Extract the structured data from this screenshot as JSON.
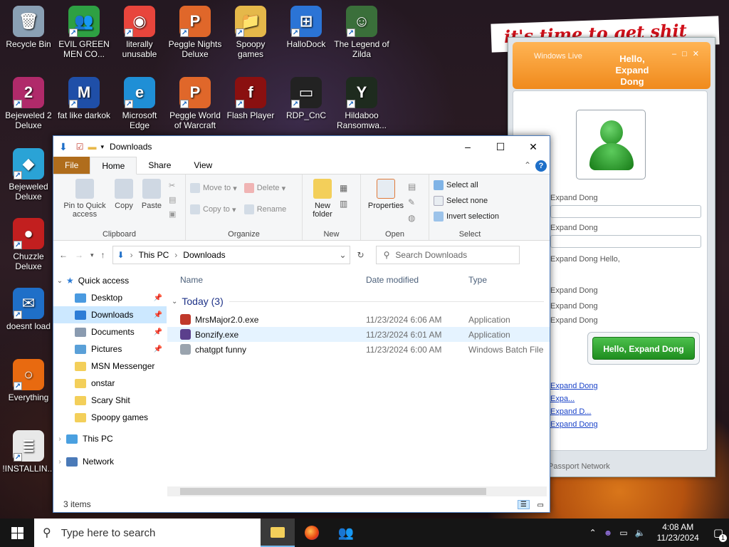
{
  "desktop": {
    "banner": "it's time to get shit",
    "icons": [
      {
        "label": "Recycle Bin",
        "color": "#8aa0b4",
        "glyph": "🗑"
      },
      {
        "label": "EVIL GREEN MEN CO...",
        "color": "#2ea043",
        "glyph": "👥"
      },
      {
        "label": "literally unusable",
        "color": "#e8453c",
        "glyph": "◉"
      },
      {
        "label": "Peggle Nights Deluxe",
        "color": "#e0672a",
        "glyph": "P"
      },
      {
        "label": "Spoopy games",
        "color": "#e5b84a",
        "glyph": "📁"
      },
      {
        "label": "HalloDock",
        "color": "#2b74d6",
        "glyph": "⊞"
      },
      {
        "label": "The Legend of Zilda",
        "color": "#3a6f3a",
        "glyph": "☺"
      },
      {
        "label": "Bejeweled 2 Deluxe",
        "color": "#b02a6a",
        "glyph": "2"
      },
      {
        "label": "fat like darkok",
        "color": "#1f4fa8",
        "glyph": "M"
      },
      {
        "label": "Microsoft Edge",
        "color": "#1f8fd6",
        "glyph": "e"
      },
      {
        "label": "Peggle World of Warcraft",
        "color": "#e0672a",
        "glyph": "P"
      },
      {
        "label": "Flash Player",
        "color": "#8a1010",
        "glyph": "f"
      },
      {
        "label": "RDP_CnC",
        "color": "#222222",
        "glyph": "▭"
      },
      {
        "label": "Hildaboo Ransomwa...",
        "color": "#1e2b1e",
        "glyph": "Y"
      },
      {
        "label": "Bejeweled Deluxe",
        "color": "#2aa3d6",
        "glyph": "◆"
      },
      {
        "label": "Chuzzle Deluxe",
        "color": "#c21f1f",
        "glyph": "●"
      },
      {
        "label": "doesnt load",
        "color": "#1f6fc8",
        "glyph": "✉"
      },
      {
        "label": "Everything",
        "color": "#e86a10",
        "glyph": "○"
      },
      {
        "label": "!INSTALLIN...",
        "color": "#e8e8e8",
        "glyph": "≣"
      }
    ]
  },
  "explorer": {
    "title": "Downloads",
    "tabs": {
      "file": "File",
      "home": "Home",
      "share": "Share",
      "view": "View"
    },
    "ribbon": {
      "pin": "Pin to Quick access",
      "copy": "Copy",
      "paste": "Paste",
      "clipboard": "Clipboard",
      "move_to": "Move to",
      "copy_to": "Copy to",
      "delete": "Delete",
      "rename": "Rename",
      "organize": "Organize",
      "new_folder": "New folder",
      "new": "New",
      "properties": "Properties",
      "open": "Open",
      "select_all": "Select all",
      "select_none": "Select none",
      "invert_selection": "Invert selection",
      "select": "Select"
    },
    "address": {
      "root": "This PC",
      "current": "Downloads",
      "search_placeholder": "Search Downloads"
    },
    "nav": {
      "quick_access": "Quick access",
      "items": [
        {
          "label": "Desktop",
          "pinned": true,
          "color": "#4a9ae0"
        },
        {
          "label": "Downloads",
          "pinned": true,
          "color": "#2c7cd6"
        },
        {
          "label": "Documents",
          "pinned": true,
          "color": "#8a9bb0"
        },
        {
          "label": "Pictures",
          "pinned": true,
          "color": "#5aa0d8"
        },
        {
          "label": "MSN Messenger",
          "pinned": false,
          "color": "#f3cf5a"
        },
        {
          "label": "onstar",
          "pinned": false,
          "color": "#f3cf5a"
        },
        {
          "label": "Scary Shit",
          "pinned": false,
          "color": "#f3cf5a"
        },
        {
          "label": "Spoopy games",
          "pinned": false,
          "color": "#f3cf5a"
        }
      ],
      "this_pc": "This PC",
      "network": "Network"
    },
    "columns": {
      "name": "Name",
      "date": "Date modified",
      "type": "Type"
    },
    "group": "Today (3)",
    "files": [
      {
        "name": "MrsMajor2.0.exe",
        "date": "11/23/2024 6:06 AM",
        "type": "Application",
        "color": "#c0392b"
      },
      {
        "name": "Bonzify.exe",
        "date": "11/23/2024 6:01 AM",
        "type": "Application",
        "color": "#5b3f8c"
      },
      {
        "name": "chatgpt funny",
        "date": "11/23/2024 6:00 AM",
        "type": "Windows Batch File",
        "color": "#9aa4ae"
      }
    ],
    "status": "3 items"
  },
  "msn": {
    "brand": "Windows Live",
    "header_name": "Hello, Expand Dong",
    "labels": [
      "Expand Dong",
      "Expand Dong",
      "Expand Dong  Hello,"
    ],
    "lines": [
      "Expand Dong",
      "Expand Dong",
      "Expand Dong"
    ],
    "button": "Hello, Expand Dong",
    "links": [
      "Expand Dong",
      "Expa...",
      "Expand D...",
      "Expand Dong"
    ],
    "footer": "Passport Network"
  },
  "taskbar": {
    "search_placeholder": "Type here to search",
    "time": "4:08 AM",
    "date": "11/23/2024",
    "notifications": "1"
  }
}
